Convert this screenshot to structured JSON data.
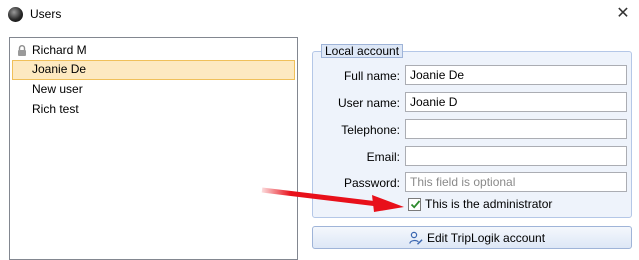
{
  "window": {
    "title": "Users",
    "close_glyph": "✕",
    "icon": "app-orb-icon"
  },
  "users": [
    {
      "name": "Richard M",
      "locked": true,
      "selected": false
    },
    {
      "name": "Joanie De",
      "locked": false,
      "selected": true
    },
    {
      "name": "New user",
      "locked": false,
      "selected": false
    },
    {
      "name": "Rich test",
      "locked": false,
      "selected": false
    }
  ],
  "account": {
    "group_title": "Local account",
    "fields": [
      {
        "label": "Full name:",
        "value": "Joanie De",
        "placeholder": ""
      },
      {
        "label": "User name:",
        "value": "Joanie D",
        "placeholder": ""
      },
      {
        "label": "Telephone:",
        "value": "",
        "placeholder": ""
      },
      {
        "label": "Email:",
        "value": "",
        "placeholder": ""
      },
      {
        "label": "Password:",
        "value": "",
        "placeholder": "This field is optional"
      }
    ],
    "admin_checkbox": {
      "label": "This is the administrator",
      "checked": true
    }
  },
  "edit_button": {
    "label": "Edit TripLogik account",
    "icon": "user-edit-icon"
  },
  "annotation": {
    "color": "#e8101a",
    "icon": "red-arrow"
  },
  "colors": {
    "selection_bg": "#fde9c1",
    "selection_border": "#f0c05a",
    "group_bg": "#eef3fb",
    "group_border": "#b4c7e7",
    "checkmark": "#2c8a2c"
  }
}
